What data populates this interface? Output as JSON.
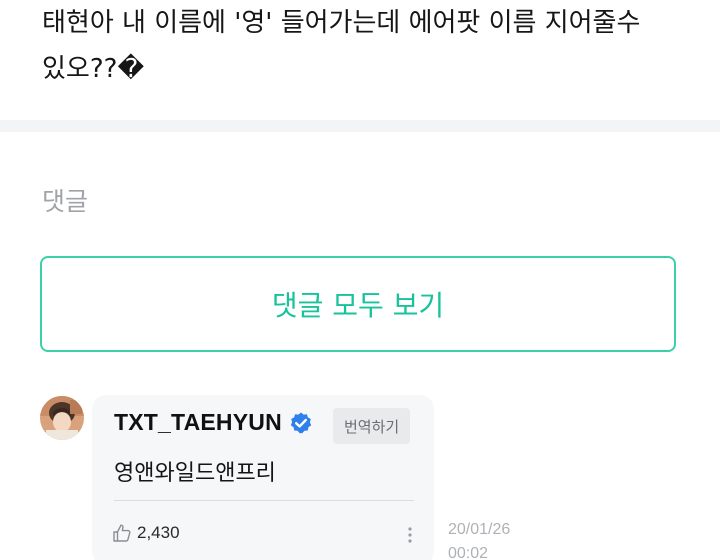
{
  "post": {
    "text_line_1": "태현아 내 이름에 '영' 들어가는데 에어팟 이름 지어줄수",
    "text_line_2": "있오??�"
  },
  "comments_section": {
    "heading": "댓글",
    "view_all_label": "댓글 모두 보기"
  },
  "comment": {
    "author": "TXT_TAEHYUN",
    "verified_icon": "verified-badge-icon",
    "translate_label": "번역하기",
    "text": "영앤와일드앤프리",
    "likes": "2,430",
    "date": "20/01/26",
    "time": "00:02"
  },
  "colors": {
    "accent": "#17c39b",
    "accent_border": "#3dcfa6",
    "verified_blue": "#2f80ed",
    "card_bg": "#f6f7f9",
    "muted_text": "#a0a4a8"
  }
}
